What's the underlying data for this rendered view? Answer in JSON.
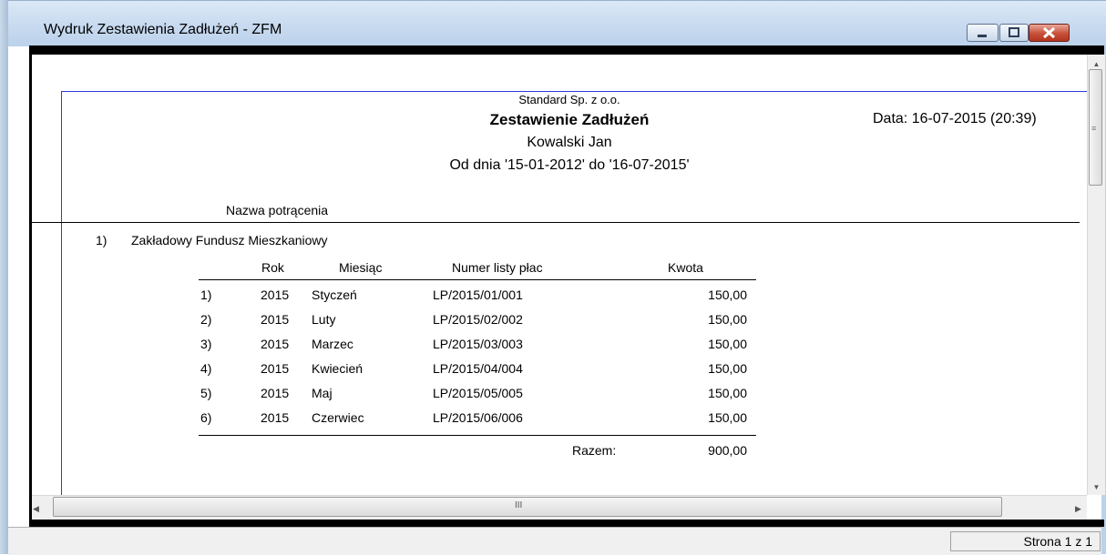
{
  "window": {
    "title": "Wydruk Zestawienia Zadłużeń - ZFM"
  },
  "report": {
    "company": "Standard Sp. z o.o.",
    "title": "Zestawienie Zadłużeń",
    "employee": "Kowalski Jan",
    "period": "Od dnia '15-01-2012' do '16-07-2015'",
    "print_date": "Data: 16-07-2015 (20:39)",
    "column_deduction_name": "Nazwa potrącenia",
    "sections": [
      {
        "number": "1)",
        "name": "Zakładowy Fundusz Mieszkaniowy",
        "headers": {
          "year": "Rok",
          "month": "Miesiąc",
          "payroll_number": "Numer listy płac",
          "amount": "Kwota"
        },
        "rows": [
          {
            "no": "1)",
            "year": "2015",
            "month": "Styczeń",
            "payroll_number": "LP/2015/01/001",
            "amount": "150,00"
          },
          {
            "no": "2)",
            "year": "2015",
            "month": "Luty",
            "payroll_number": "LP/2015/02/002",
            "amount": "150,00"
          },
          {
            "no": "3)",
            "year": "2015",
            "month": "Marzec",
            "payroll_number": "LP/2015/03/003",
            "amount": "150,00"
          },
          {
            "no": "4)",
            "year": "2015",
            "month": "Kwiecień",
            "payroll_number": "LP/2015/04/004",
            "amount": "150,00"
          },
          {
            "no": "5)",
            "year": "2015",
            "month": "Maj",
            "payroll_number": "LP/2015/05/005",
            "amount": "150,00"
          },
          {
            "no": "6)",
            "year": "2015",
            "month": "Czerwiec",
            "payroll_number": "LP/2015/06/006",
            "amount": "150,00"
          }
        ],
        "total_label": "Razem:",
        "total_value": "900,00"
      }
    ]
  },
  "scrollbar": {
    "grip": "III"
  },
  "statusbar": {
    "page": "Strona 1 z 1"
  },
  "colors": {
    "page_frame": "#2a3bd6",
    "close_button": "#c75039",
    "titlebar": "#c6d9ef"
  },
  "icons": [
    "minimize-icon",
    "maximize-icon",
    "close-icon",
    "scroll-up-icon",
    "scroll-down-icon",
    "scroll-left-icon",
    "scroll-right-icon"
  ]
}
